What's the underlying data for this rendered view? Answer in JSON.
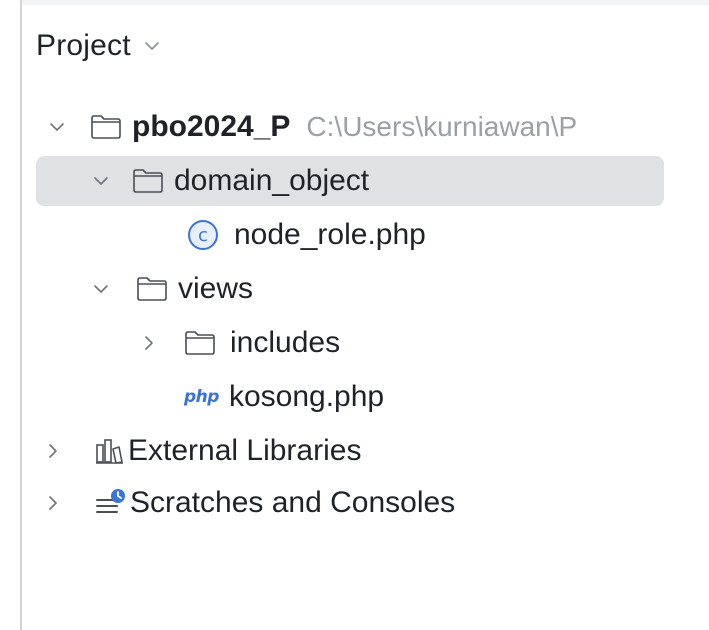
{
  "panel": {
    "title": "Project"
  },
  "tree": {
    "root": {
      "name": "pbo2024_P",
      "path": "C:\\Users\\kurniawan\\P"
    },
    "domain_object": {
      "name": "domain_object"
    },
    "node_role": {
      "name": "node_role.php",
      "icon_letter": "c"
    },
    "views": {
      "name": "views"
    },
    "includes": {
      "name": "includes"
    },
    "kosong": {
      "name": "kosong.php",
      "icon_text": "php"
    },
    "external_libraries": {
      "name": "External Libraries"
    },
    "scratches": {
      "name": "Scratches and Consoles"
    }
  },
  "colors": {
    "selection": "#dfe1e5",
    "text": "#1f2329",
    "muted": "#9aa0a6",
    "accent": "#3b74d8"
  },
  "icons": {
    "expanded": "chevron-down-icon",
    "collapsed": "chevron-right-icon",
    "folder": "folder-icon",
    "class": "class-icon",
    "php": "php-file-icon",
    "libraries": "library-icon",
    "scratches": "scratches-icon"
  }
}
